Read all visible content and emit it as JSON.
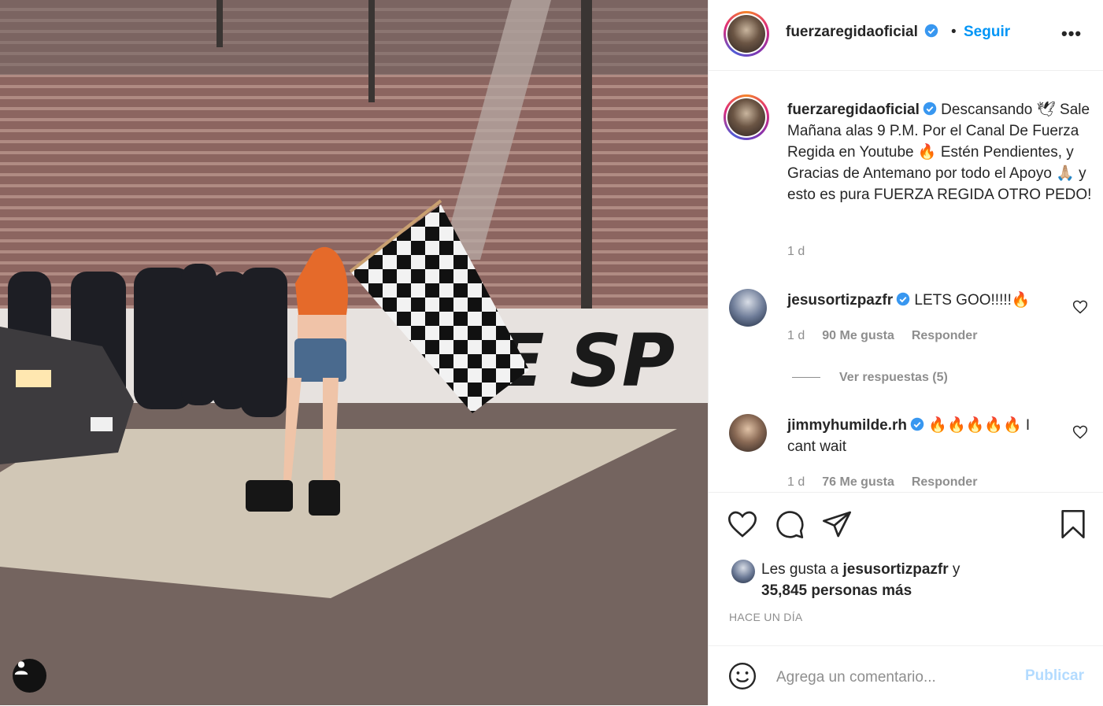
{
  "post": {
    "username": "fuerzaregidaoficial",
    "follow_label": "Seguir",
    "dot": "•",
    "more_label": "•••"
  },
  "caption": {
    "username": "fuerzaregidaoficial",
    "text": "Descansando 🕊 Sale Mañana alas 9 P.M. Por el Canal De Fuerza Regida en Youtube 🔥 Estén Pendientes, y Gracias de Antemano por todo el Apoyo 🙏🏼 y esto es pura FUERZA REGIDA OTRO PEDO!",
    "time": "1 d"
  },
  "comments": [
    {
      "username": "jesusortizpazfr",
      "text": "LETS GOO!!!!!🔥",
      "time": "1 d",
      "likes": "90 Me gusta",
      "reply": "Responder",
      "view_replies": "Ver respuestas (5)"
    },
    {
      "username": "jimmyhumilde.rh",
      "text": "🔥🔥🔥🔥🔥 I cant wait",
      "time": "1 d",
      "likes": "76 Me gusta",
      "reply": "Responder"
    }
  ],
  "likes": {
    "prefix": "Les gusta a",
    "user": "jesusortizpazfr",
    "conj": "y",
    "count": "35,845 personas más"
  },
  "timestamp": "HACE UN DÍA",
  "comment_box": {
    "placeholder": "Agrega un comentario...",
    "publish_label": "Publicar"
  },
  "icons": {
    "like": "heart-icon",
    "comment": "comment-icon",
    "share": "share-icon",
    "save": "bookmark-icon",
    "emoji": "emoji-icon",
    "tagged": "user-icon",
    "verified": "verified-badge-icon"
  },
  "colors": {
    "accent": "#0095f6",
    "publish_disabled": "#b3dbff",
    "text": "#262626",
    "muted": "#8e8e8e",
    "verified": "#3897f0"
  }
}
